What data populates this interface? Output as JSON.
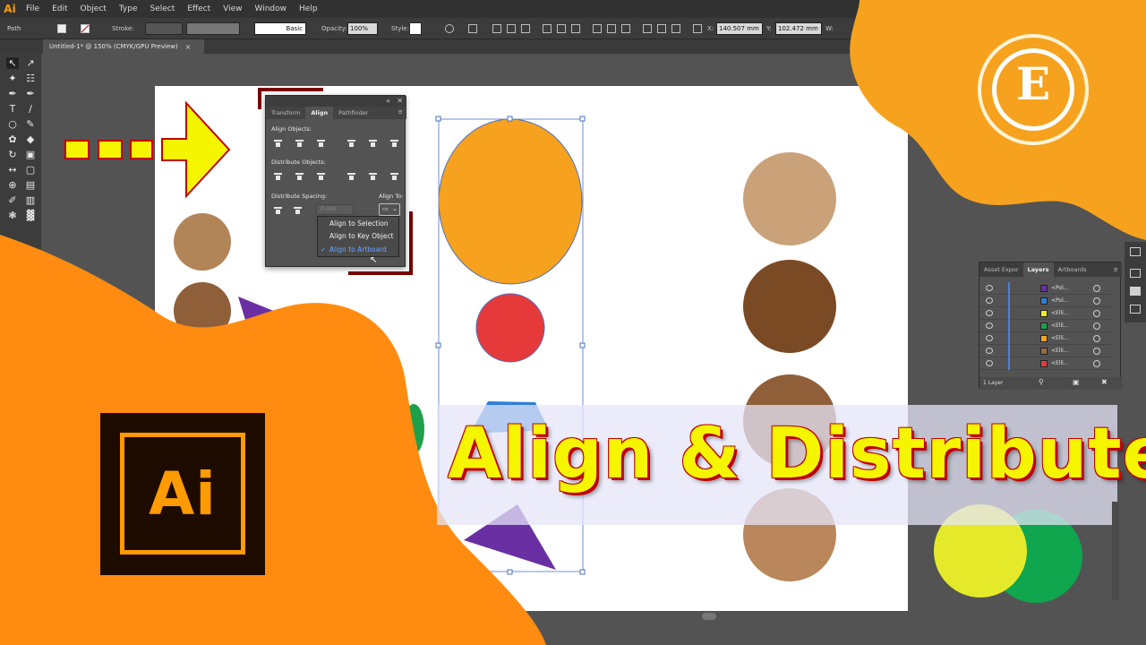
{
  "app": {
    "logo_text": "Ai",
    "menu": [
      "File",
      "Edit",
      "Object",
      "Type",
      "Select",
      "Effect",
      "View",
      "Window",
      "Help"
    ]
  },
  "control_bar": {
    "selection_label": "Path",
    "stroke_label": "Stroke:",
    "brush_label": "Basic",
    "opacity_label": "Opacity:",
    "opacity_value": "100%",
    "style_label": "Style:",
    "x_label": "X:",
    "x_value": "140.507 mm",
    "y_label": "Y:",
    "y_value": "102.472 mm",
    "w_label": "W:"
  },
  "document_tab": {
    "title": "Untitled-1* @ 150% (CMYK/GPU Preview)",
    "close_glyph": "×"
  },
  "align_panel": {
    "tabs": [
      "Transform",
      "Align",
      "Pathfinder"
    ],
    "active_tab": "Align",
    "align_objects_label": "Align Objects:",
    "distribute_objects_label": "Distribute Objects:",
    "distribute_spacing_label": "Distribute Spacing:",
    "align_to_label": "Align To:",
    "spacing_placeholder": "0 mm",
    "align_to_menu": [
      {
        "label": "Align to Selection",
        "checked": false
      },
      {
        "label": "Align to Key Object",
        "checked": false
      },
      {
        "label": "Align to Artboard",
        "checked": true
      }
    ],
    "check_glyph": "✓"
  },
  "layers_panel": {
    "tabs": [
      "Asset Expor",
      "Layers",
      "Artboards"
    ],
    "active_tab": "Layers",
    "rows": [
      {
        "name": "<Pol...",
        "swatch": "#6a2fa3"
      },
      {
        "name": "<Pol...",
        "swatch": "#2f7fd6"
      },
      {
        "name": "<Elli...",
        "swatch": "#f2ea1a"
      },
      {
        "name": "<Elli...",
        "swatch": "#1ea04a"
      },
      {
        "name": "<Elli...",
        "swatch": "#f6a21e"
      },
      {
        "name": "<Elli...",
        "swatch": "#9a6b40"
      },
      {
        "name": "<Elli...",
        "swatch": "#e63a3a"
      }
    ],
    "footer_label": "1 Layer"
  },
  "overlay": {
    "title": "Align & Distribute",
    "ai_logo_text": "Ai",
    "channel_logo_letter": "E"
  },
  "colors": {
    "orange_blob": "#ff8c10",
    "brand_orange": "#f6a21e",
    "title_yellow": "#f5f500",
    "title_outline": "#c00000"
  }
}
